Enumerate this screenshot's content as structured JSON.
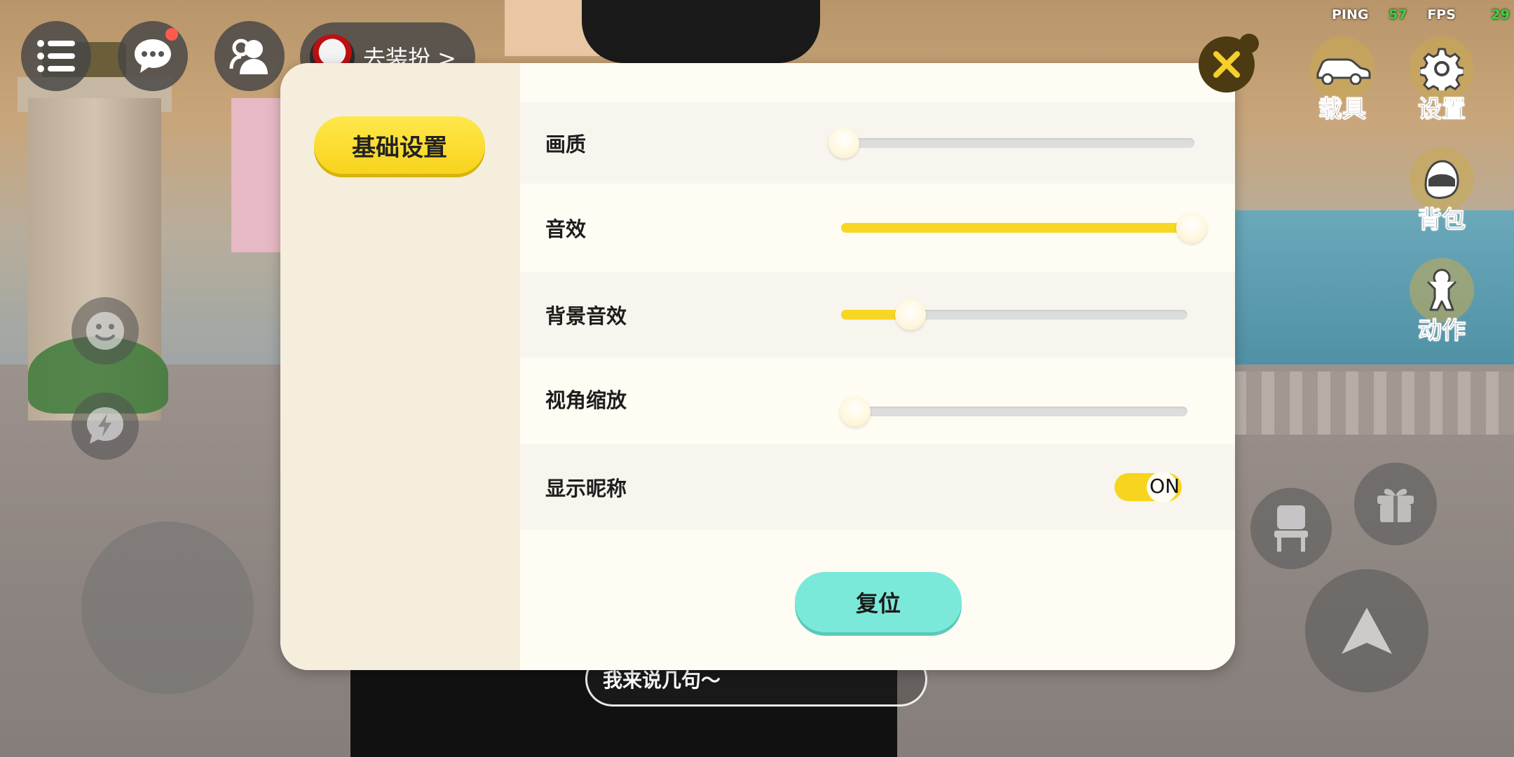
{
  "hud": {
    "dress_up_label": "去装扮 >",
    "ping_label": "PING",
    "ping_value": "57",
    "fps_label": "FPS",
    "fps_value": "29"
  },
  "side_menu": {
    "vehicle": "载具",
    "settings": "设置",
    "backpack": "背包",
    "action": "动作"
  },
  "panel": {
    "tab_basic": "基础设置",
    "rows": {
      "quality": {
        "label": "画质",
        "value": 0
      },
      "sfx": {
        "label": "音效",
        "value": 1
      },
      "bgm": {
        "label": "背景音效",
        "value": 0.2
      },
      "zoom": {
        "label": "视角缩放",
        "value": 0.04
      },
      "nickname": {
        "label": "显示昵称",
        "toggle": "ON"
      }
    },
    "reset_label": "复位"
  },
  "chat": {
    "placeholder": "我来说几句～"
  },
  "colors": {
    "accent": "#f8d624",
    "reset": "#7be9d9",
    "notification": "#ff5a4e",
    "fps_value": "#39d43f"
  }
}
